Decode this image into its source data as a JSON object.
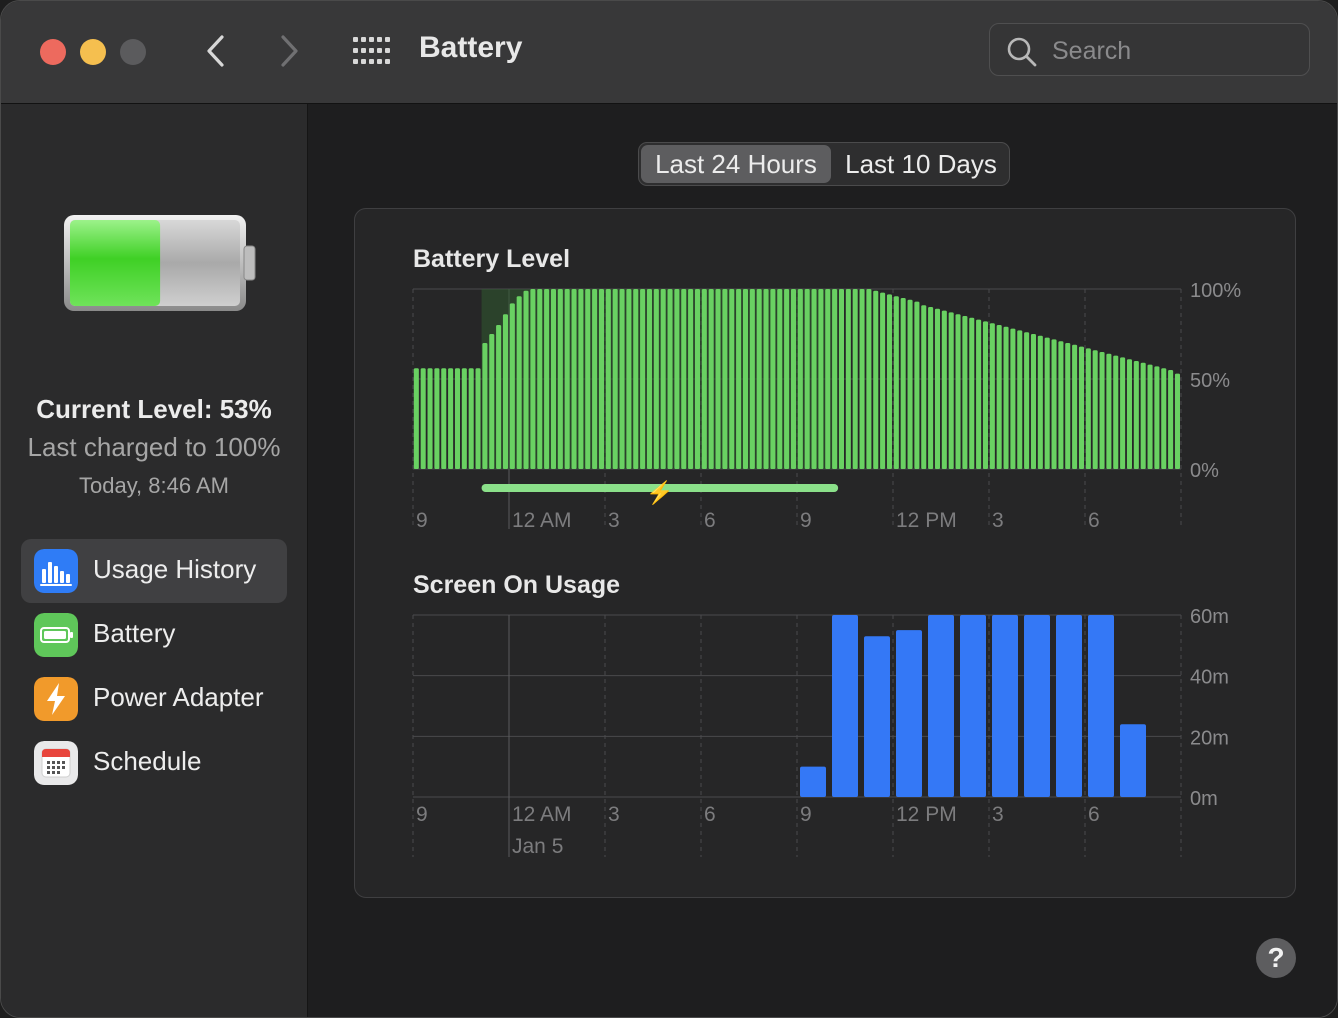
{
  "window": {
    "title": "Battery",
    "search_placeholder": "Search"
  },
  "sidebar": {
    "current_level": "Current Level: 53%",
    "last_charged": "Last charged to 100%",
    "charged_time": "Today, 8:46 AM",
    "battery_fill_fraction": 0.53,
    "items": [
      {
        "label": "Usage History",
        "icon": "usage-history-icon",
        "selected": true
      },
      {
        "label": "Battery",
        "icon": "battery-icon",
        "selected": false
      },
      {
        "label": "Power Adapter",
        "icon": "power-adapter-icon",
        "selected": false
      },
      {
        "label": "Schedule",
        "icon": "schedule-icon",
        "selected": false
      }
    ]
  },
  "tabs": [
    {
      "label": "Last 24 Hours",
      "active": true
    },
    {
      "label": "Last 10 Days",
      "active": false
    }
  ],
  "colors": {
    "battery_bar": "#69d162",
    "screen_bar": "#3478f6",
    "charging": "#8be08a"
  },
  "chart_data": [
    {
      "type": "bar",
      "title": "Battery Level",
      "x_ticks": [
        "9",
        "12 AM",
        "3",
        "6",
        "9",
        "12 PM",
        "3",
        "6"
      ],
      "y_ticks": [
        "100%",
        "50%",
        "0%"
      ],
      "ylim": [
        0,
        100
      ],
      "bar_slots": 112,
      "values": [
        56,
        56,
        56,
        56,
        56,
        56,
        56,
        56,
        56,
        56,
        70,
        75,
        80,
        86,
        92,
        96,
        99,
        100,
        100,
        100,
        100,
        100,
        100,
        100,
        100,
        100,
        100,
        100,
        100,
        100,
        100,
        100,
        100,
        100,
        100,
        100,
        100,
        100,
        100,
        100,
        100,
        100,
        100,
        100,
        100,
        100,
        100,
        100,
        100,
        100,
        100,
        100,
        100,
        100,
        100,
        100,
        100,
        100,
        100,
        100,
        100,
        100,
        100,
        100,
        100,
        100,
        100,
        99,
        98,
        97,
        96,
        95,
        94,
        93,
        91,
        90,
        89,
        88,
        87,
        86,
        85,
        84,
        83,
        82,
        81,
        80,
        79,
        78,
        77,
        76,
        75,
        74,
        73,
        72,
        71,
        70,
        69,
        68,
        67,
        66,
        65,
        64,
        63,
        62,
        61,
        60,
        59,
        58,
        57,
        56,
        55,
        53
      ],
      "charging_bar_range": [
        10,
        62
      ],
      "charging_label": "⚡"
    },
    {
      "type": "bar",
      "title": "Screen On Usage",
      "x_ticks": [
        "9",
        "12 AM",
        "3",
        "6",
        "9",
        "12 PM",
        "3",
        "6"
      ],
      "x_sublabel": "Jan 5",
      "y_ticks": [
        "60m",
        "40m",
        "20m",
        "0m"
      ],
      "ylim": [
        0,
        60
      ],
      "bar_slots": 24,
      "values": [
        0,
        0,
        0,
        0,
        0,
        0,
        0,
        0,
        0,
        0,
        0,
        0,
        10,
        60,
        53,
        55,
        60,
        60,
        60,
        60,
        60,
        60,
        24,
        0
      ]
    }
  ]
}
